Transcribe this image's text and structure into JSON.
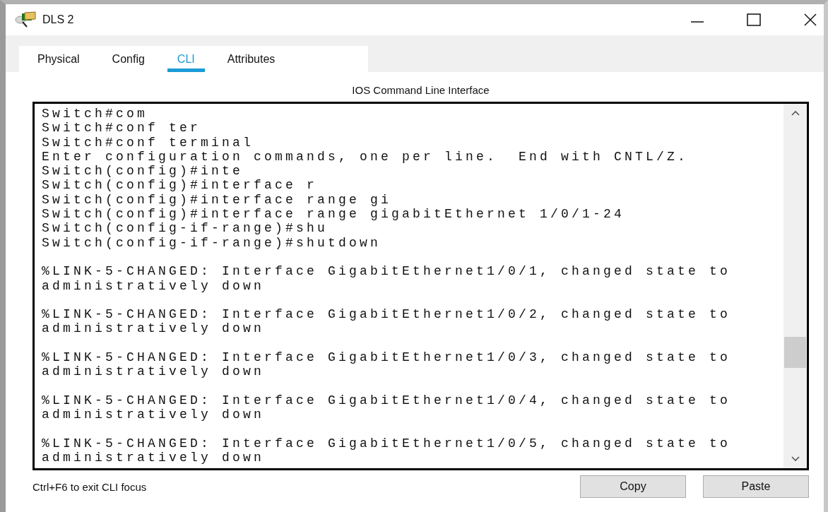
{
  "window": {
    "title": "DLS 2"
  },
  "tabs": [
    {
      "label": "Physical",
      "selected": false
    },
    {
      "label": "Config",
      "selected": false
    },
    {
      "label": "CLI",
      "selected": true
    },
    {
      "label": "Attributes",
      "selected": false
    }
  ],
  "panel_title": "IOS Command Line Interface",
  "terminal": {
    "entries": [
      {
        "kind": "command",
        "lines": [
          "Switch#com"
        ]
      },
      {
        "kind": "command",
        "lines": [
          "Switch#conf ter"
        ]
      },
      {
        "kind": "command",
        "lines": [
          "Switch#conf terminal"
        ]
      },
      {
        "kind": "command",
        "lines": [
          "Enter configuration commands, one per line.  End with CNTL/Z."
        ]
      },
      {
        "kind": "command",
        "lines": [
          "Switch(config)#inte"
        ]
      },
      {
        "kind": "command",
        "lines": [
          "Switch(config)#interface r"
        ]
      },
      {
        "kind": "command",
        "lines": [
          "Switch(config)#interface range gi"
        ]
      },
      {
        "kind": "command",
        "lines": [
          "Switch(config)#interface range gigabitEthernet 1/0/1-24"
        ]
      },
      {
        "kind": "command",
        "lines": [
          "Switch(config-if-range)#shu"
        ]
      },
      {
        "kind": "command",
        "lines": [
          "Switch(config-if-range)#shutdown"
        ]
      },
      {
        "kind": "log",
        "lines": [
          "%LINK-5-CHANGED: Interface GigabitEthernet1/0/1, changed state to",
          "administratively down"
        ]
      },
      {
        "kind": "log",
        "lines": [
          "%LINK-5-CHANGED: Interface GigabitEthernet1/0/2, changed state to",
          "administratively down"
        ]
      },
      {
        "kind": "log",
        "lines": [
          "%LINK-5-CHANGED: Interface GigabitEthernet1/0/3, changed state to",
          "administratively down"
        ]
      },
      {
        "kind": "log",
        "lines": [
          "%LINK-5-CHANGED: Interface GigabitEthernet1/0/4, changed state to",
          "administratively down"
        ]
      },
      {
        "kind": "log",
        "lines": [
          "%LINK-5-CHANGED: Interface GigabitEthernet1/0/5, changed state to",
          "administratively down"
        ]
      }
    ]
  },
  "hint": "Ctrl+F6 to exit CLI focus",
  "buttons": [
    "Copy",
    "Paste"
  ]
}
